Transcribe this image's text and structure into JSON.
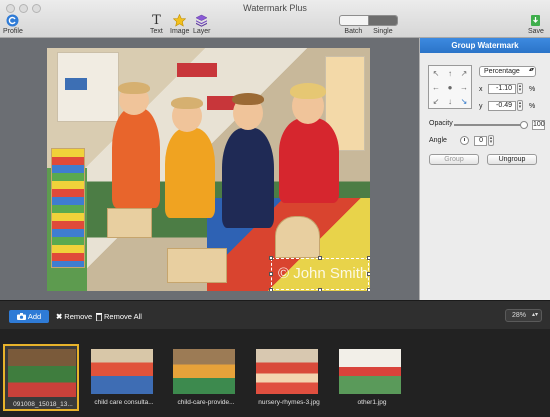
{
  "window": {
    "title": "Watermark Plus"
  },
  "toolbar": {
    "profile_label": "Profile",
    "text_label": "Text",
    "image_label": "Image",
    "layer_label": "Layer",
    "batch_label": "Batch",
    "single_label": "Single",
    "save_label": "Save"
  },
  "watermark": {
    "text": "© John Smith"
  },
  "panel": {
    "title": "Group Watermark",
    "unit": "Percentage",
    "x_label": "x",
    "x_value": "-1.10",
    "x_unit": "%",
    "y_label": "y",
    "y_value": "-0.49",
    "y_unit": "%",
    "opacity_label": "Opacity",
    "opacity_value": "100",
    "opacity_level": 1.0,
    "angle_label": "Angle",
    "angle_value": "0",
    "group_label": "Group",
    "ungroup_label": "Ungroup"
  },
  "bottom": {
    "add_label": "Add",
    "remove_label": "Remove",
    "remove_all_label": "Remove All",
    "zoom": "28%"
  },
  "thumbnails": [
    {
      "caption": "091008_15018_13..."
    },
    {
      "caption": "child care consulta..."
    },
    {
      "caption": "child-care-provide..."
    },
    {
      "caption": "nursery-rhymes-3.jpg"
    },
    {
      "caption": "other1.jpg"
    }
  ],
  "colors": {
    "accent": "#2b74c8",
    "selection": "#e8b32b"
  }
}
